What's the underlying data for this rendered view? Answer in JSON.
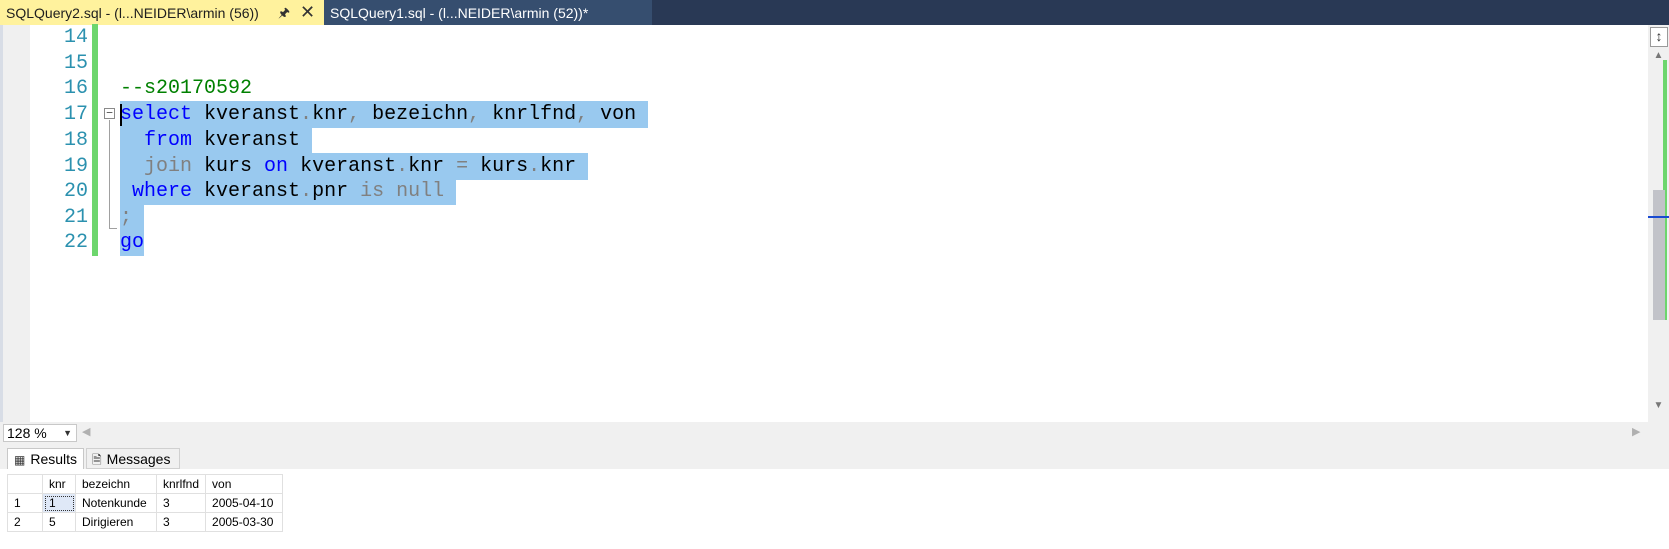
{
  "tabs": [
    {
      "label": "SQLQuery2.sql - (l...NEIDER\\armin (56))",
      "active": true,
      "pin_icon": "pin-icon",
      "close_icon": "close-icon"
    },
    {
      "label": "SQLQuery1.sql - (l...NEIDER\\armin (52))*",
      "active": false
    }
  ],
  "editor": {
    "line_numbers": [
      "14",
      "15",
      "16",
      "17",
      "18",
      "19",
      "20",
      "21",
      "22"
    ],
    "comment": "--s20170592",
    "l17": {
      "kw_select": "select",
      "t1": " kveranst",
      "d1": ".",
      "t2": "knr",
      "c1": ",",
      "t3": " bezeichn",
      "c2": ",",
      "t4": " knrlfnd",
      "c3": ",",
      "t5": " von "
    },
    "l18": {
      "indent": "  ",
      "kw_from": "from",
      "t1": " kveranst "
    },
    "l19": {
      "indent": "  ",
      "kw_join": "join",
      "t1": " kurs ",
      "kw_on": "on",
      "t2": " kveranst",
      "d1": ".",
      "t3": "knr ",
      "op": "=",
      "t4": " kurs",
      "d2": ".",
      "t5": "knr "
    },
    "l20": {
      "indent": " ",
      "kw_where": "where",
      "t1": " kveranst",
      "d1": ".",
      "t2": "pnr ",
      "kw_is": "is",
      "sp": " ",
      "kw_null": "null",
      "t3": " "
    },
    "l21": {
      "semi": ";",
      "t1": " "
    },
    "l22": {
      "kw_go": "go"
    }
  },
  "zoom": {
    "value": "128 %"
  },
  "results_tabs": {
    "results": "Results",
    "messages": "Messages"
  },
  "grid": {
    "columns": [
      "knr",
      "bezeichn",
      "knrlfnd",
      "von"
    ],
    "rows": [
      {
        "n": "1",
        "knr": "1",
        "bezeichn": "Notenkunde",
        "knrlfnd": "3",
        "von": "2005-04-10"
      },
      {
        "n": "2",
        "knr": "5",
        "bezeichn": "Dirigieren",
        "knrlfnd": "3",
        "von": "2005-03-30"
      }
    ]
  },
  "colors": {
    "tab_active": "#fff29d",
    "tabstrip": "#293955",
    "selection": "#99c9ef",
    "keyword": "#0000ff",
    "comment": "#008000",
    "line_number": "#2b91af",
    "change_marker": "#6dd66d"
  }
}
